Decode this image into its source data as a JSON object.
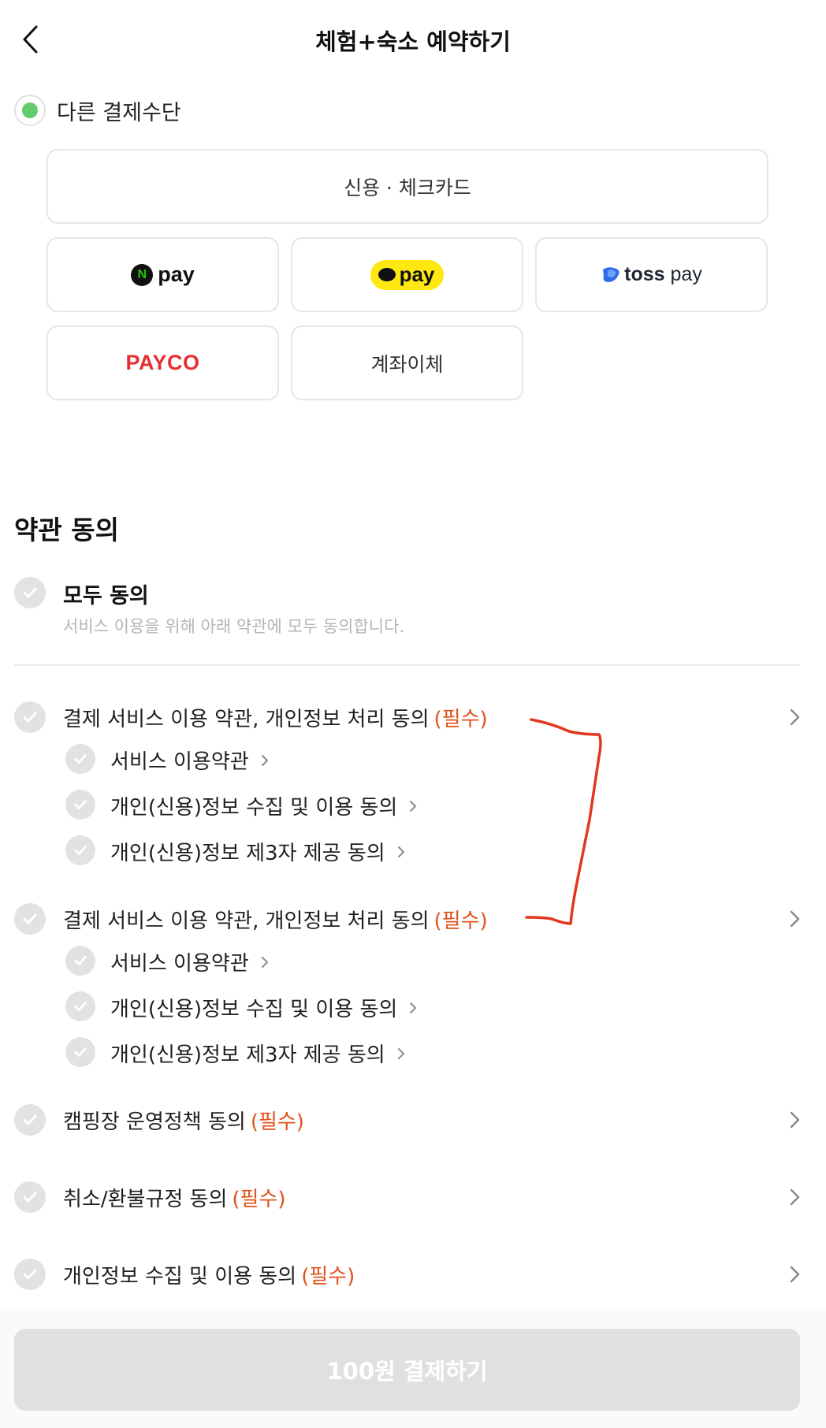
{
  "header": {
    "title": "체험+숙소 예약하기",
    "back_icon": "chevron-left-icon"
  },
  "payment": {
    "option_label": "다른 결제수단",
    "selected": true,
    "accent_color": "#63cc6e",
    "methods": {
      "card": "신용 · 체크카드",
      "npay": "pay",
      "npay_badge": "N",
      "kakaopay": "pay",
      "tosspay_bold": "toss",
      "tosspay_light": "pay",
      "payco": "PAYCO",
      "transfer": "계좌이체"
    }
  },
  "terms": {
    "section_title": "약관 동의",
    "agree_all": {
      "label": "모두 동의",
      "description": "서비스 이용을 위해 아래 약관에 모두 동의합니다."
    },
    "required_tag": "(필수)",
    "required_color": "#e2511b",
    "groups": [
      {
        "label": "결제 서비스 이용 약관, 개인정보 처리 동의",
        "children": [
          "서비스 이용약관",
          "개인(신용)정보 수집 및 이용 동의",
          "개인(신용)정보 제3자 제공 동의"
        ]
      },
      {
        "label": "결제 서비스 이용 약관, 개인정보 처리 동의",
        "children": [
          "서비스 이용약관",
          "개인(신용)정보 수집 및 이용 동의",
          "개인(신용)정보 제3자 제공 동의"
        ]
      }
    ],
    "items": [
      {
        "label": "캠핑장 운영정책 동의"
      },
      {
        "label": "취소/환불규정 동의"
      },
      {
        "label": "개인정보 수집 및 이용 동의"
      }
    ]
  },
  "footer": {
    "submit_label": "100원 결제하기"
  },
  "annotation_color": "#e0391f"
}
